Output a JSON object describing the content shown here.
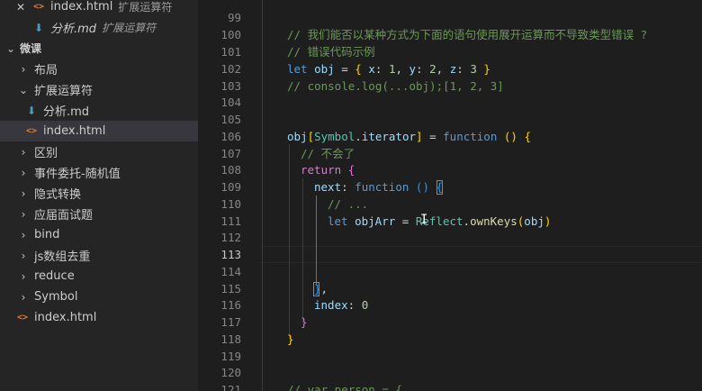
{
  "sidebar": {
    "open_editors": [
      {
        "name": "index.html",
        "desc": "扩展运算符"
      },
      {
        "name": "分析.md",
        "desc": "扩展运算符"
      }
    ],
    "section_title": "微课",
    "tree": [
      {
        "label": "布局"
      },
      {
        "label": "扩展运算符"
      },
      {
        "label": "分析.md"
      },
      {
        "label": "index.html"
      },
      {
        "label": "区别"
      },
      {
        "label": "事件委托-随机值"
      },
      {
        "label": "隐式转换"
      },
      {
        "label": "应届面试题"
      },
      {
        "label": "bind"
      },
      {
        "label": "js数组去重"
      },
      {
        "label": "reduce"
      },
      {
        "label": "Symbol"
      },
      {
        "label": "index.html"
      }
    ]
  },
  "editor": {
    "line_numbers": [
      "99",
      "100",
      "101",
      "102",
      "103",
      "104",
      "105",
      "106",
      "107",
      "108",
      "109",
      "110",
      "111",
      "112",
      "113",
      "114",
      "115",
      "116",
      "117",
      "118",
      "119",
      "120",
      "121"
    ],
    "active_line": "113",
    "code": {
      "l100": "// 我们能否以某种方式为下面的语句使用展开运算而不导致类型错误 ?",
      "l101": "// 错误代码示例",
      "l102": {
        "kw": "let",
        "var": "obj",
        "op": "=",
        "b1": "{",
        "k1": "x",
        "v1": "1",
        "k2": "y",
        "v2": "2",
        "k3": "z",
        "v3": "3",
        "b2": "}"
      },
      "l103": "// console.log(...obj);[1, 2, 3]",
      "l106": {
        "obj": "obj",
        "lb": "[",
        "sym": "Symbol",
        "prop": "iterator",
        "rb": "]",
        "op": "=",
        "fn": "function",
        "parens": "()",
        "brace": "{"
      },
      "l107": "// 不会了",
      "l108": {
        "kw": "return",
        "brace": "{"
      },
      "l109": {
        "key": "next",
        "fn": "function",
        "parens": "()",
        "brace": "{"
      },
      "l110": "// ...",
      "l111": {
        "kw": "let",
        "var": "objArr",
        "op": "=",
        "obj": "Reflect",
        "method": "ownKeys",
        "lp": "(",
        "arg": "obj",
        "rp": ")"
      },
      "l115": {
        "brace": "}",
        "comma": ","
      },
      "l116": {
        "key": "index",
        "val": "0"
      },
      "l117": "}",
      "l118": "}",
      "l121": "// var person = {"
    }
  }
}
